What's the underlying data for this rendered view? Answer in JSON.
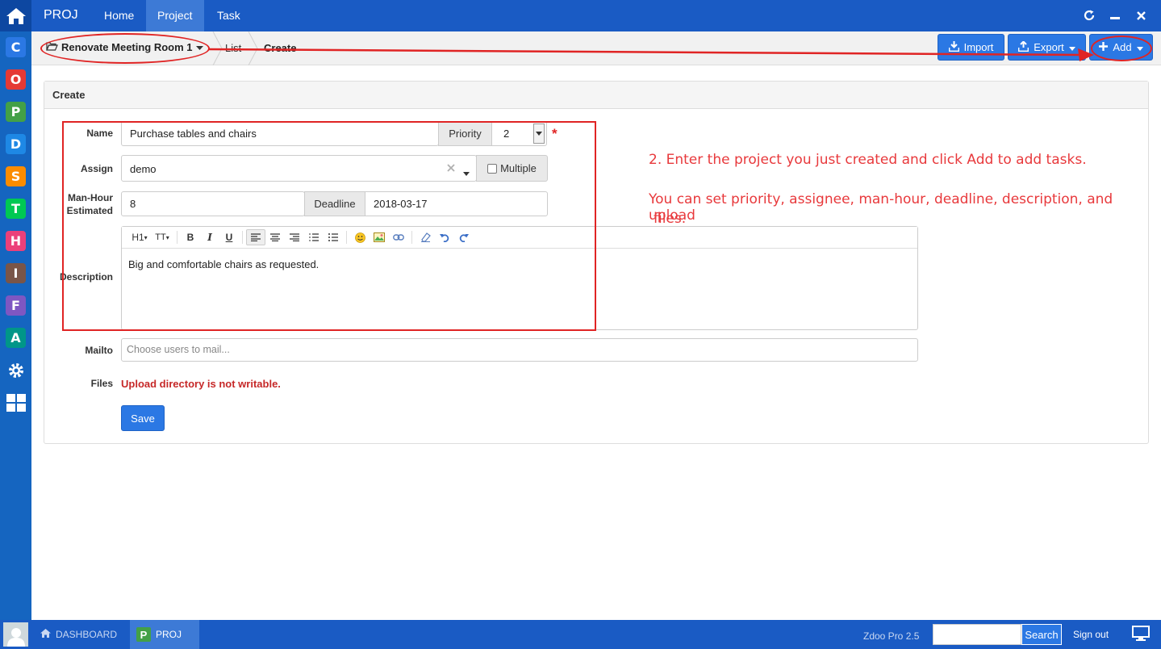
{
  "topbar": {
    "brand": "PROJ",
    "nav": [
      {
        "label": "Home",
        "active": false
      },
      {
        "label": "Project",
        "active": true
      },
      {
        "label": "Task",
        "active": false
      }
    ]
  },
  "rail": {
    "apps": [
      {
        "letter": "C",
        "color": "#2b78e4"
      },
      {
        "letter": "O",
        "color": "#e53935"
      },
      {
        "letter": "P",
        "color": "#43a047"
      },
      {
        "letter": "D",
        "color": "#1e88e5"
      },
      {
        "letter": "S",
        "color": "#fb8c00"
      },
      {
        "letter": "T",
        "color": "#00c853"
      },
      {
        "letter": "H",
        "color": "#ec407a"
      },
      {
        "letter": "I",
        "color": "#795548"
      },
      {
        "letter": "F",
        "color": "#7e57c2"
      },
      {
        "letter": "A",
        "color": "#009688"
      }
    ]
  },
  "breadcrumb": {
    "project": "Renovate Meeting Room 1",
    "list": "List",
    "create": "Create"
  },
  "toolbar": {
    "import_label": "Import",
    "export_label": "Export",
    "add_label": "Add"
  },
  "form": {
    "panel_title": "Create",
    "name_label": "Name",
    "name_value": "Purchase tables and chairs",
    "priority_label": "Priority",
    "priority_value": "2",
    "required_mark": "*",
    "assign_label": "Assign",
    "assign_value": "demo",
    "multiple_label": "Multiple",
    "manhour_label_1": "Man-Hour",
    "manhour_label_2": "Estimated",
    "manhour_value": "8",
    "deadline_label": "Deadline",
    "deadline_value": "2018-03-17",
    "description_label": "Description",
    "description_value": "Big and comfortable chairs as requested.",
    "mailto_label": "Mailto",
    "mailto_placeholder": "Choose users to mail...",
    "files_label": "Files",
    "files_error": "Upload directory is not writable.",
    "save_label": "Save"
  },
  "editor_toolbar": {
    "heading": "H1",
    "fontsize": "TT",
    "bold": "B",
    "italic": "I",
    "underline": "U"
  },
  "annotations": {
    "note_1": "2. Enter the project you just created and click Add to add tasks.",
    "note_2_line1": "You can set priority, assignee, man-hour, deadline, description, and upload",
    "note_2_line2": "files."
  },
  "taskbar": {
    "dashboard_label": "DASHBOARD",
    "proj_label": "PROJ",
    "version": "Zdoo Pro 2.5",
    "search_label": "Search",
    "signout_label": "Sign out"
  },
  "colors": {
    "primary": "#2b78e4",
    "nav": "#1a5bc4",
    "annotation": "#e02424",
    "error": "#c62828"
  }
}
